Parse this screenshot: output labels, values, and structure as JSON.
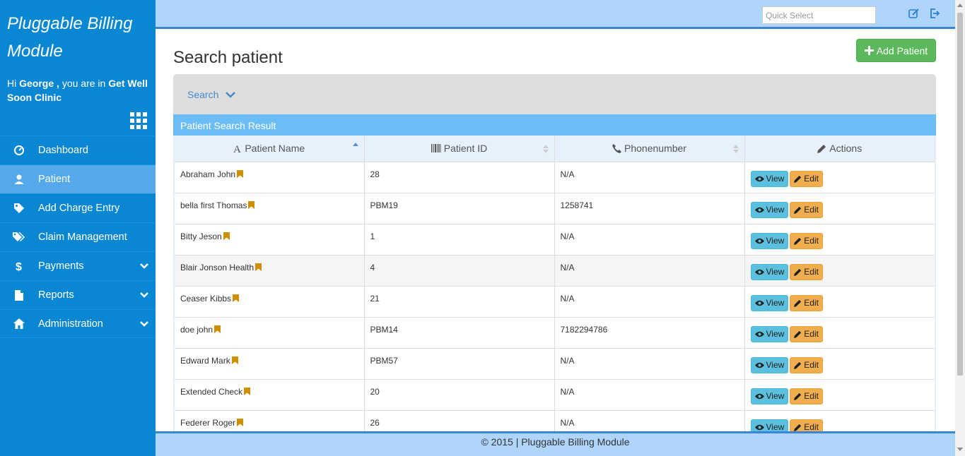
{
  "brand": {
    "line1": "Pluggable Billing",
    "line2": "Module"
  },
  "greeting": {
    "hi": "Hi",
    "user": "George ,",
    "mid": "you are in",
    "clinic": "Get Well Soon Clinic"
  },
  "sidebar": {
    "items": [
      {
        "label": "Dashboard",
        "icon": "dashboard-icon",
        "active": false,
        "expandable": false
      },
      {
        "label": "Patient",
        "icon": "user-icon",
        "active": true,
        "expandable": false
      },
      {
        "label": "Add Charge Entry",
        "icon": "tag-icon",
        "active": false,
        "expandable": false
      },
      {
        "label": "Claim Management",
        "icon": "tags-icon",
        "active": false,
        "expandable": false
      },
      {
        "label": "Payments",
        "icon": "dollar-icon",
        "active": false,
        "expandable": true
      },
      {
        "label": "Reports",
        "icon": "file-icon",
        "active": false,
        "expandable": true
      },
      {
        "label": "Administration",
        "icon": "home-icon",
        "active": false,
        "expandable": true
      }
    ]
  },
  "topbar": {
    "quick_select_placeholder": "Quick Select"
  },
  "page": {
    "title": "Search patient",
    "add_label": "Add Patient"
  },
  "search": {
    "label": "Search"
  },
  "result": {
    "title": "Patient Search Result"
  },
  "table": {
    "headers": {
      "name": "Patient Name",
      "id": "Patient ID",
      "phone": "Phonenumber",
      "actions": "Actions"
    },
    "rows": [
      {
        "name": "Abraham John",
        "id": "28",
        "phone": "N/A"
      },
      {
        "name": "bella first Thomas",
        "id": "PBM19",
        "phone": "1258741"
      },
      {
        "name": "Bitty Jeson",
        "id": "1",
        "phone": "N/A"
      },
      {
        "name": "Blair Jonson Health",
        "id": "4",
        "phone": "N/A"
      },
      {
        "name": "Ceaser Kibbs",
        "id": "21",
        "phone": "N/A"
      },
      {
        "name": "doe john",
        "id": "PBM14",
        "phone": "7182294786"
      },
      {
        "name": "Edward Mark",
        "id": "PBM57",
        "phone": "N/A"
      },
      {
        "name": "Extended Check",
        "id": "20",
        "phone": "N/A"
      },
      {
        "name": "Federer Roger",
        "id": "26",
        "phone": "N/A"
      }
    ],
    "view_label": "View",
    "edit_label": "Edit"
  },
  "footer": {
    "text": "© 2015 | Pluggable Billing Module"
  },
  "colors": {
    "sidebar": "#0a87d2",
    "active": "#55a8ea",
    "topbar": "#afd5fb",
    "success": "#5cb85c",
    "info": "#5bc0de",
    "warning": "#f0ad4e",
    "bookmark": "#d08f00"
  }
}
